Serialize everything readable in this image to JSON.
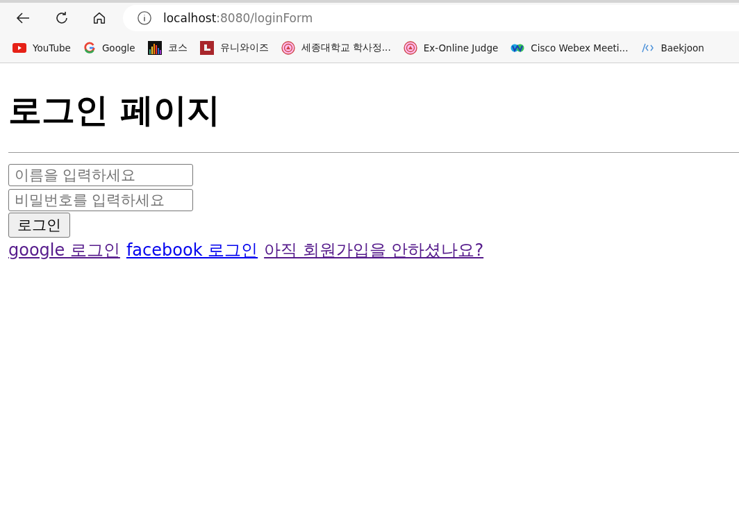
{
  "toolbar": {
    "address": {
      "host": "localhost",
      "path": ":8080/loginForm"
    }
  },
  "bookmarks": [
    {
      "kind": "youtube",
      "label": "YouTube"
    },
    {
      "kind": "google",
      "label": "Google"
    },
    {
      "kind": "bars",
      "label": "코스"
    },
    {
      "kind": "square",
      "label": "유니와이즈"
    },
    {
      "kind": "seal",
      "label": "세종대학교 학사정..."
    },
    {
      "kind": "seal",
      "label": "Ex-Online Judge"
    },
    {
      "kind": "webex",
      "label": "Cisco Webex Meeti..."
    },
    {
      "kind": "code",
      "label": "Baekjoon"
    }
  ],
  "page": {
    "heading": "로그인 페이지",
    "fields": [
      {
        "placeholder": "이름을 입력하세요"
      },
      {
        "placeholder": "비밀번호를 입력하세요"
      }
    ],
    "button": "로그인",
    "links": [
      {
        "label": "google 로그인",
        "visited": true
      },
      {
        "label": "facebook 로그인",
        "visited": false
      },
      {
        "label": "아직 회원가입을 안하셨나요?",
        "visited": true
      }
    ]
  }
}
